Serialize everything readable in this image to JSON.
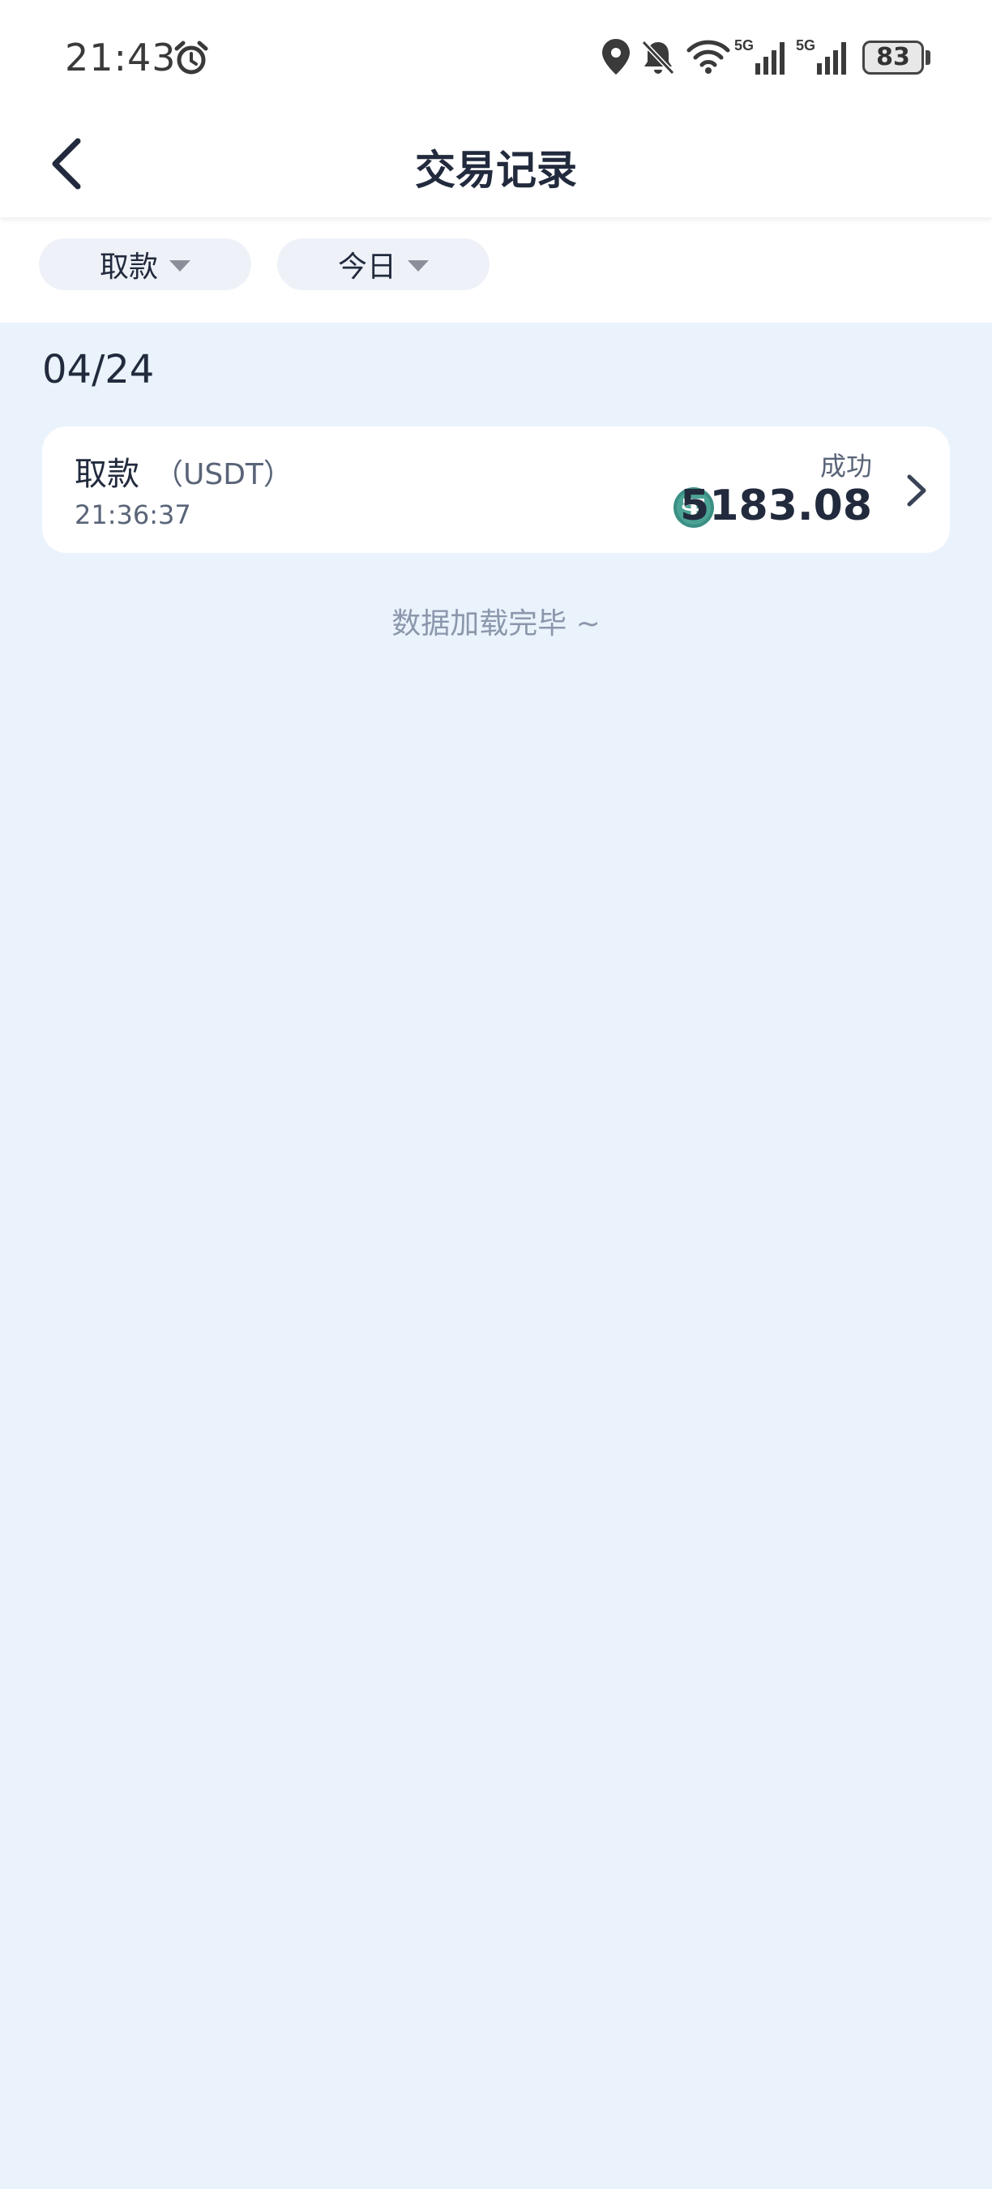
{
  "status_bar": {
    "time": "21:43",
    "battery": "83",
    "network_1": "5G",
    "network_2": "5G",
    "icons": [
      "alarm-icon",
      "location-icon",
      "bell-off-icon",
      "wifi-icon",
      "signal-icon",
      "signal-icon",
      "battery-icon"
    ]
  },
  "header": {
    "title": "交易记录",
    "back_icon": "chevron-left-icon"
  },
  "filters": {
    "type_label": "取款",
    "date_label": "今日"
  },
  "records": {
    "date": "04/24",
    "items": [
      {
        "title": "取款",
        "currency": "（USDT）",
        "time": "21:36:37",
        "status": "成功",
        "amount": "5183.08",
        "coin_icon": "usdt-icon"
      }
    ]
  },
  "footer": {
    "load_complete": "数据加载完毕 ~"
  },
  "colors": {
    "background": "#eaf2fc",
    "card": "#ffffff",
    "text_primary": "#222a3d",
    "text_secondary": "#5a6478",
    "usdt_green": "#26a17b"
  }
}
